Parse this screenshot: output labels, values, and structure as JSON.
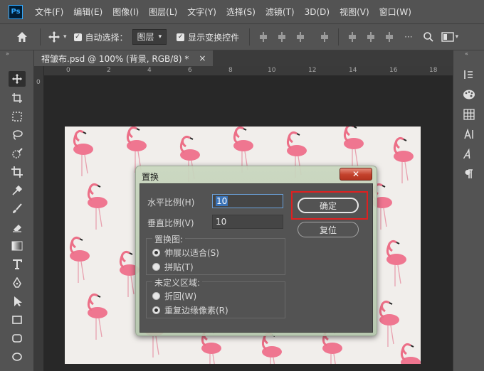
{
  "menubar": {
    "logo": "Ps",
    "items": [
      "文件(F)",
      "编辑(E)",
      "图像(I)",
      "图层(L)",
      "文字(Y)",
      "选择(S)",
      "滤镜(T)",
      "3D(D)",
      "视图(V)",
      "窗口(W)"
    ]
  },
  "options": {
    "auto_select_label": "自动选择：",
    "auto_select_target": "图层",
    "show_transform_label": "显示变换控件"
  },
  "document": {
    "tab_title": "褶皱布.psd @ 100% (背景, RGB/8) *",
    "close": "×",
    "ruler_labels": [
      "0",
      "2",
      "4",
      "6",
      "8",
      "10",
      "12",
      "14",
      "16",
      "18"
    ]
  },
  "dialog": {
    "title": "置换",
    "close": "✕",
    "h_scale_label": "水平比例(H)",
    "h_scale_value": "10",
    "v_scale_label": "垂直比例(V)",
    "v_scale_value": "10",
    "ok_label": "确定",
    "reset_label": "复位",
    "map_group_title": "置换图:",
    "stretch_label": "伸展以适合(S)",
    "tile_label": "拼贴(T)",
    "undefined_group_title": "未定义区域:",
    "wrap_label": "折回(W)",
    "repeat_label": "重复边缘像素(R)"
  },
  "colors": {
    "ui_bg": "#535353",
    "workspace": "#282828",
    "highlight": "#e02020",
    "flamingo": "#ec6f87"
  }
}
